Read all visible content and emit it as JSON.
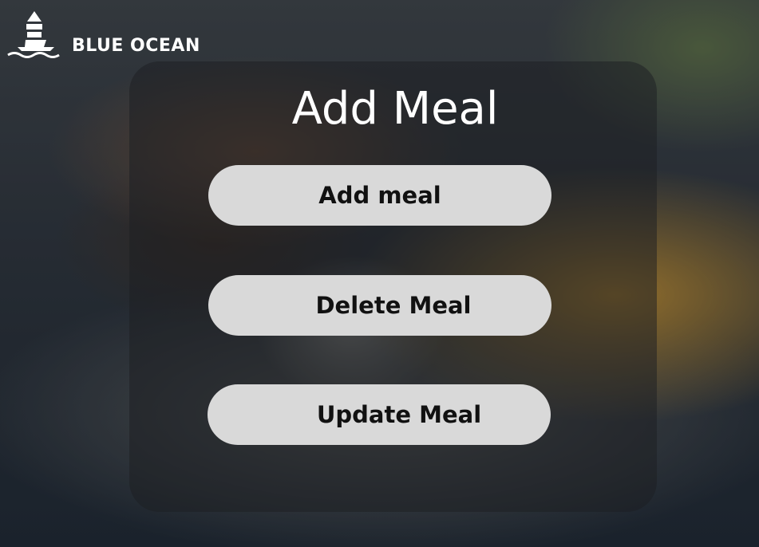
{
  "brand": {
    "name": "BLUE OCEAN",
    "logo_icon": "sailing-ship-icon"
  },
  "page": {
    "title": "Add Meal"
  },
  "actions": {
    "add_label": "Add meal",
    "delete_label": "Delete Meal",
    "update_label": "Update Meal"
  },
  "colors": {
    "button_bg": "#d9d9d9",
    "button_text": "#111111",
    "title_text": "#ffffff",
    "panel_overlay": "rgba(28,30,34,0.52)"
  }
}
